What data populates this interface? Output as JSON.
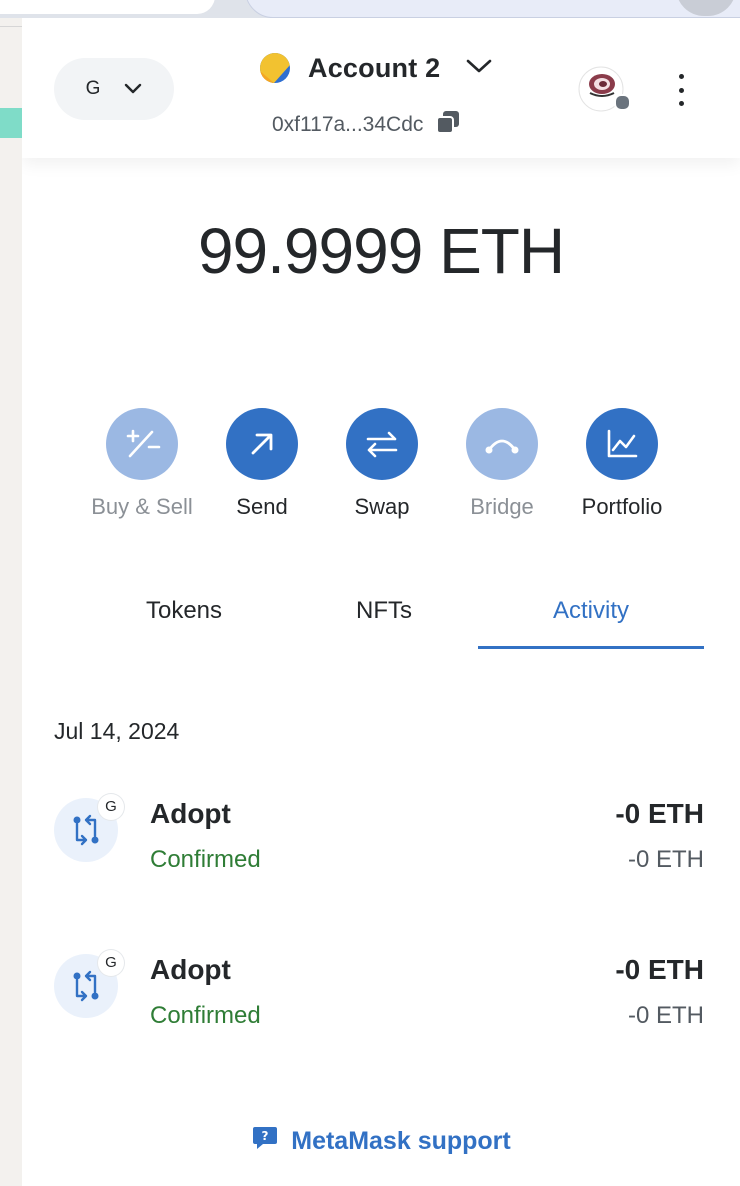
{
  "header": {
    "network": {
      "label": "G"
    },
    "account": {
      "name": "Account 2",
      "address": "0xf117a...34Cdc"
    }
  },
  "balance": {
    "text": "99.9999 ETH"
  },
  "actions": [
    {
      "label": "Buy & Sell",
      "icon": "plus-minus-icon",
      "enabled": false
    },
    {
      "label": "Send",
      "icon": "arrow-up-right-icon",
      "enabled": true
    },
    {
      "label": "Swap",
      "icon": "swap-arrows-icon",
      "enabled": true
    },
    {
      "label": "Bridge",
      "icon": "bridge-icon",
      "enabled": false
    },
    {
      "label": "Portfolio",
      "icon": "chart-icon",
      "enabled": true
    }
  ],
  "tabs": [
    {
      "label": "Tokens",
      "active": false
    },
    {
      "label": "NFTs",
      "active": false
    },
    {
      "label": "Activity",
      "active": true
    }
  ],
  "activity": {
    "date": "Jul 14, 2024",
    "transactions": [
      {
        "badge": "G",
        "title": "Adopt",
        "status": "Confirmed",
        "amount": "-0 ETH",
        "fiat": "-0 ETH"
      },
      {
        "badge": "G",
        "title": "Adopt",
        "status": "Confirmed",
        "amount": "-0 ETH",
        "fiat": "-0 ETH"
      }
    ]
  },
  "footer": {
    "support_label": "MetaMask support"
  },
  "colors": {
    "accent": "#3271c4",
    "accent_disabled": "#9bb8e3",
    "success": "#2f7d36",
    "text": "#24272a",
    "muted": "#535a61"
  }
}
